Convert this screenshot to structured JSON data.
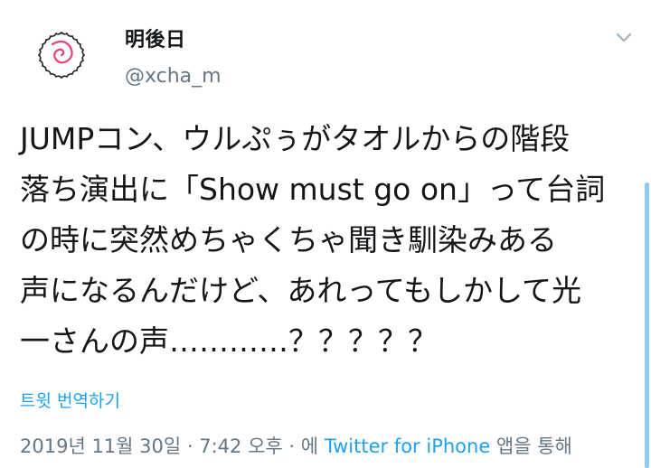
{
  "author": {
    "display_name": "明後日",
    "handle": "@xcha_m",
    "avatar_icon": "naruto-swirl-icon"
  },
  "menu": {
    "caret_icon": "chevron-down-icon"
  },
  "tweet": {
    "lines": [
      "JUMPコン、ウルぷぅがタオルからの階段",
      "落ち演出に「Show must go on」って台詞",
      "の時に突然めちゃくちゃ聞き馴染みある",
      "声になるんだけど、あれってもしかして光",
      "一さんの声…………？？？？？"
    ]
  },
  "translate": {
    "label": "트윗 번역하기"
  },
  "meta": {
    "date": "2019년 11월 30일",
    "separator": " · ",
    "time": "7:42 오후",
    "prefix": "에 ",
    "source": "Twitter for iPhone",
    "suffix": " 앱을 통해"
  },
  "colors": {
    "link": "#1da1f2",
    "secondary_text": "#657786",
    "primary_text": "#14171a",
    "avatar_swirl": "#e0457b"
  }
}
